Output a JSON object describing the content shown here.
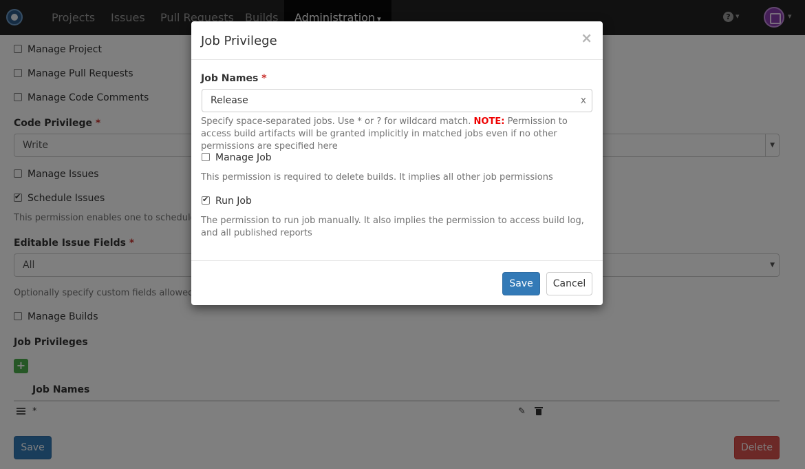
{
  "navbar": {
    "items": [
      "Projects",
      "Issues",
      "Pull Requests",
      "Builds"
    ],
    "active": "Administration",
    "active_caret": "⌄"
  },
  "form": {
    "manage_project": "Manage Project",
    "manage_pull_requests": "Manage Pull Requests",
    "manage_code_comments": "Manage Code Comments",
    "code_privilege_label": "Code Privilege",
    "code_privilege_value": "Write",
    "manage_issues": "Manage Issues",
    "schedule_issues": "Schedule Issues",
    "schedule_help": "This permission enables one to schedule issu",
    "editable_fields_label": "Editable Issue Fields",
    "editable_fields_value": "All",
    "editable_help": "Optionally specify custom fields allowed to e",
    "manage_builds": "Manage Builds",
    "job_privileges_label": "Job Privileges",
    "plus": "+",
    "table_header": "Job Names",
    "table_rows": [
      "*"
    ],
    "save": "Save",
    "delete": "Delete",
    "required": "*"
  },
  "modal": {
    "title": "Job Privilege",
    "close": "×",
    "job_names_label": "Job Names",
    "required": "*",
    "job_names_value": "Release",
    "clear": "x",
    "help_1": "Specify space-separated jobs. Use * or ? for wildcard match.",
    "help_note": "NOTE:",
    "help_2": "Permission to access build artifacts will be granted implicitly in matched jobs even if no other permissions are specified here",
    "manage_job_label": "Manage Job",
    "manage_job_checked": false,
    "manage_job_help": "This permission is required to delete builds. It implies all other job permissions",
    "run_job_label": "Run Job",
    "run_job_checked": true,
    "run_job_help": "The permission to run job manually. It also implies the permission to access build log, and all published reports",
    "save": "Save",
    "cancel": "Cancel"
  },
  "colors": {
    "navbar": "#222222",
    "primary": "#337ab7",
    "danger": "#d9534f",
    "success": "#4cae4c",
    "note": "#ee0000"
  },
  "icons": [
    "app-logo-icon",
    "help-icon",
    "chevron-down-icon",
    "avatar",
    "plus-icon",
    "drag-handle-icon",
    "edit-icon",
    "trash-icon",
    "close-icon",
    "clear-icon"
  ]
}
